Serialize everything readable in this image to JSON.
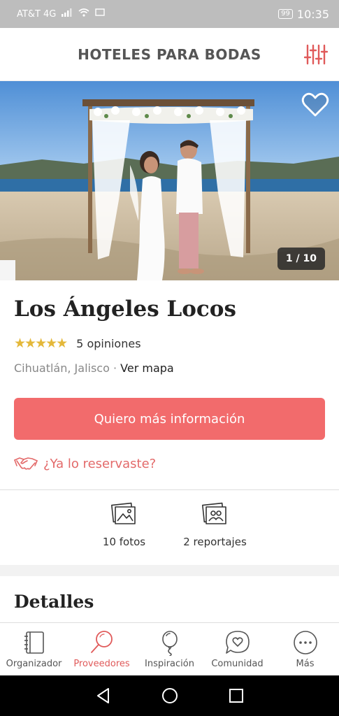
{
  "status_bar": {
    "carrier": "AT&T 4G",
    "battery": "99",
    "time": "10:35"
  },
  "header": {
    "title": "HOTELES PARA BODAS",
    "filter_icon": "sliders-icon"
  },
  "hero": {
    "photo_counter": "1 / 10",
    "favorite_icon": "heart-outline-icon"
  },
  "venue": {
    "name": "Los Ángeles Locos",
    "rating_stars": 5,
    "reviews": "5 opiniones",
    "city": "Cihuatlán, Jalisco",
    "separator": "·",
    "map_link": "Ver mapa"
  },
  "actions": {
    "cta_label": "Quiero más información",
    "booked_label": "¿Ya lo reservaste?",
    "booked_icon": "handshake-icon"
  },
  "media": [
    {
      "label": "10 fotos",
      "icon": "photo-icon"
    },
    {
      "label": "2 reportajes",
      "icon": "photo-album-icon"
    }
  ],
  "details": {
    "title": "Detalles"
  },
  "bottom_nav": [
    {
      "label": "Organizador",
      "icon": "planner-book-icon",
      "active": false
    },
    {
      "label": "Proveedores",
      "icon": "magnifier-icon",
      "active": true
    },
    {
      "label": "Inspiración",
      "icon": "balloon-icon",
      "active": false
    },
    {
      "label": "Comunidad",
      "icon": "chat-heart-icon",
      "active": false
    },
    {
      "label": "Más",
      "icon": "more-dots-icon",
      "active": false
    }
  ],
  "colors": {
    "accent": "#f26b6c",
    "link_accent": "#e36a6a",
    "star": "#e4b83a"
  }
}
